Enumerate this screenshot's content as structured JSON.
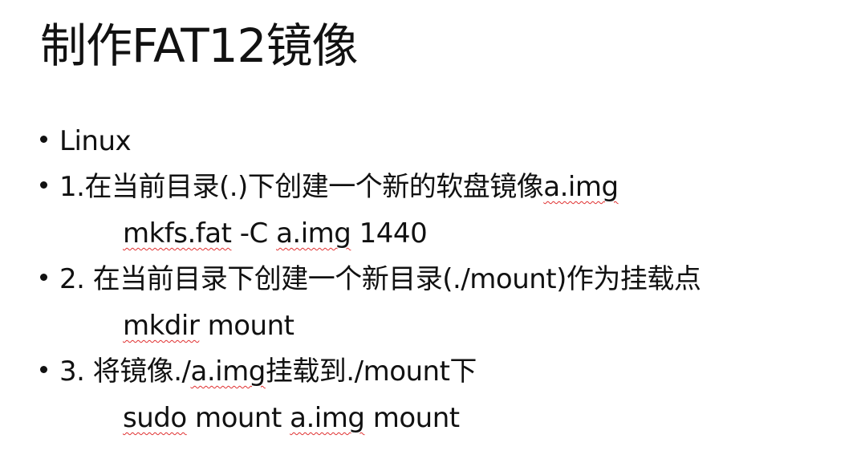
{
  "title": "制作FAT12镜像",
  "bullets": [
    {
      "text": "Linux"
    },
    {
      "prefix": "1.在当前目录(.)下创建一个新的软盘镜像",
      "flag": "a.img"
    },
    {
      "text": "2. 在当前目录下创建一个新目录(./mount)作为挂载点"
    },
    {
      "prefix": "3. 将镜像./",
      "flag": "a.img",
      "suffix": "挂载到./mount下"
    }
  ],
  "commands": [
    {
      "w1": "mkfs.fat",
      "w2": " -C ",
      "w3": "a.img",
      "w4": " 1440"
    },
    {
      "w1": "mkdir",
      "w2": " mount"
    },
    {
      "w1": "sudo",
      "w2": " mount ",
      "w3": "a.img",
      "w4": " mount"
    }
  ],
  "colors": {
    "text": "#111111",
    "spellcheck_underline": "#e03030",
    "background": "#ffffff"
  }
}
